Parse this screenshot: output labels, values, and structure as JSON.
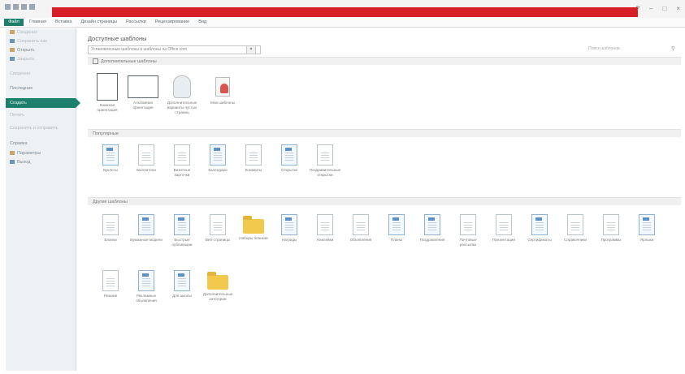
{
  "window": {
    "title_bar_color": "#d61f26",
    "accent": "#1f7f6d",
    "controls": [
      "?",
      "–",
      "□",
      "×"
    ]
  },
  "ribbon": {
    "file_tab": "Файл",
    "tabs": [
      "Главная",
      "Вставка",
      "Дизайн страницы",
      "Рассылки",
      "Рецензирование",
      "Вид"
    ]
  },
  "sidebar": {
    "top_items": [
      {
        "label": "Сведения",
        "icon": "info-icon"
      },
      {
        "label": "Сохранить как",
        "icon": "save-icon"
      },
      {
        "label": "Открыть",
        "icon": "open-folder-icon"
      },
      {
        "label": "Закрыть",
        "icon": "close-icon"
      }
    ],
    "recent": "Последние",
    "create": "Создать",
    "print": "Печать",
    "share": "Сохранить и отправить",
    "help": "Справка",
    "params": "Параметры",
    "exit": "Выход"
  },
  "main": {
    "heading": "Доступные шаблоны",
    "template_select": "Установленные шаблоны и шаблоны на Office.com",
    "search_placeholder": "Поиск шаблонов",
    "more_layouts": "Дополнительные шаблоны",
    "top_items": [
      {
        "label": "Книжная ориентация",
        "icon": "portrait-page-icon"
      },
      {
        "label": "Альбомная ориентация",
        "icon": "landscape-page-icon"
      },
      {
        "label": "Дополнительные варианты пустых страниц",
        "icon": "blank-pages-icon"
      },
      {
        "label": "Мои шаблоны",
        "icon": "my-templates-icon"
      }
    ],
    "section_popular": "Популярные",
    "popular": [
      {
        "label": "Буклеты",
        "icon": "booklet-icon"
      },
      {
        "label": "Бюллетени",
        "icon": "newsletter-icon"
      },
      {
        "label": "Визитные карточки",
        "icon": "business-card-icon"
      },
      {
        "label": "Календари",
        "icon": "calendar-icon"
      },
      {
        "label": "Конверты",
        "icon": "envelope-icon"
      },
      {
        "label": "Открытки",
        "icon": "greeting-card-icon"
      },
      {
        "label": "Поздравительные открытки",
        "icon": "congrats-card-icon"
      }
    ],
    "section_more": "Другие шаблоны",
    "more_row1": [
      {
        "label": "Бланки",
        "icon": "form-icon"
      },
      {
        "label": "Бумажные модели",
        "icon": "paper-model-icon"
      },
      {
        "label": "Быстрые публикации",
        "icon": "quick-publication-icon"
      },
      {
        "label": "Веб-страницы",
        "icon": "web-page-icon"
      },
      {
        "label": "Наборы бланков",
        "icon": "folder-icon"
      },
      {
        "label": "Награды",
        "icon": "award-icon"
      },
      {
        "label": "Наклейки",
        "icon": "label-icon"
      },
      {
        "label": "Объявления",
        "icon": "announcement-icon"
      },
      {
        "label": "Планы",
        "icon": "plan-icon"
      },
      {
        "label": "Поздравления",
        "icon": "greeting-icon"
      },
      {
        "label": "Почтовые рассылки",
        "icon": "mailing-icon"
      },
      {
        "label": "Презентации",
        "icon": "presentation-icon"
      },
      {
        "label": "Сертификаты",
        "icon": "certificate-icon"
      },
      {
        "label": "Справочники",
        "icon": "reference-icon"
      },
      {
        "label": "Программы",
        "icon": "program-icon"
      },
      {
        "label": "Ярлыки",
        "icon": "tag-icon"
      }
    ],
    "more_row2": [
      {
        "label": "Резюме",
        "icon": "resume-icon"
      },
      {
        "label": "Рекламные объявления",
        "icon": "advert-icon"
      },
      {
        "label": "Для школы",
        "icon": "school-icon"
      },
      {
        "label": "Дополнительные категории",
        "icon": "folder-icon"
      }
    ]
  }
}
